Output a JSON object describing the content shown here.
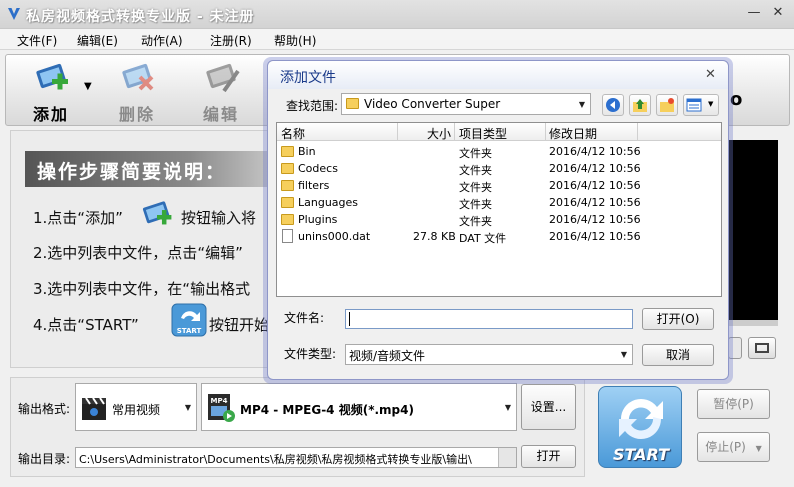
{
  "window": {
    "title": "私房视频格式转换专业版 - 未注册",
    "min_glyph": "—",
    "close_glyph": "✕"
  },
  "menu": [
    "文件(F)",
    "编辑(E)",
    "动作(A)",
    "注册(R)",
    "帮助(H)"
  ],
  "toolbar": {
    "add_label": "添加",
    "delete_label": "删除",
    "edit_label": "编辑",
    "dropdown_glyph": "▼",
    "partial_o": "o"
  },
  "steps": {
    "title": "操作步骤简要说明：",
    "step1a": "1.点击“添加”",
    "step1b": "按钮输入将",
    "step2": "2.选中列表中文件，点击“编辑”",
    "step3": "3.选中列表中文件，在“输出格式",
    "step4a": "4.点击“START”",
    "step4b": "按钮开始"
  },
  "output": {
    "format_label": "输出格式:",
    "category": "常用视频",
    "format": "MP4 - MPEG-4 视频(*.mp4)",
    "settings_label": "设置...",
    "dir_label": "输出目录:",
    "dir_value": "C:\\Users\\Administrator\\Documents\\私房视频\\私房视频格式转换专业版\\输出\\",
    "open_label": "打开"
  },
  "controls": {
    "start_label": "START",
    "pause_label": "暂停(P)",
    "stop_label": "停止(P)"
  },
  "dialog": {
    "title": "添加文件",
    "close_glyph": "✕",
    "lookin_label": "查找范围:",
    "lookin_value": "Video Converter Super",
    "columns": [
      "名称",
      "大小",
      "项目类型",
      "修改日期"
    ],
    "files": [
      {
        "name": "Bin",
        "size": "",
        "type": "文件夹",
        "date": "2016/4/12 10:56",
        "icon": "folder-icon"
      },
      {
        "name": "Codecs",
        "size": "",
        "type": "文件夹",
        "date": "2016/4/12 10:56",
        "icon": "folder-icon"
      },
      {
        "name": "filters",
        "size": "",
        "type": "文件夹",
        "date": "2016/4/12 10:56",
        "icon": "folder-icon"
      },
      {
        "name": "Languages",
        "size": "",
        "type": "文件夹",
        "date": "2016/4/12 10:56",
        "icon": "folder-icon"
      },
      {
        "name": "Plugins",
        "size": "",
        "type": "文件夹",
        "date": "2016/4/12 10:56",
        "icon": "folder-icon"
      },
      {
        "name": "unins000.dat",
        "size": "27.8 KB",
        "type": "DAT 文件",
        "date": "2016/4/12 10:56",
        "icon": "file-icon"
      }
    ],
    "filename_label": "文件名:",
    "filename_value": "",
    "filetype_label": "文件类型:",
    "filetype_value": "视频/音频文件",
    "open_label": "打开(O)",
    "cancel_label": "取消"
  }
}
